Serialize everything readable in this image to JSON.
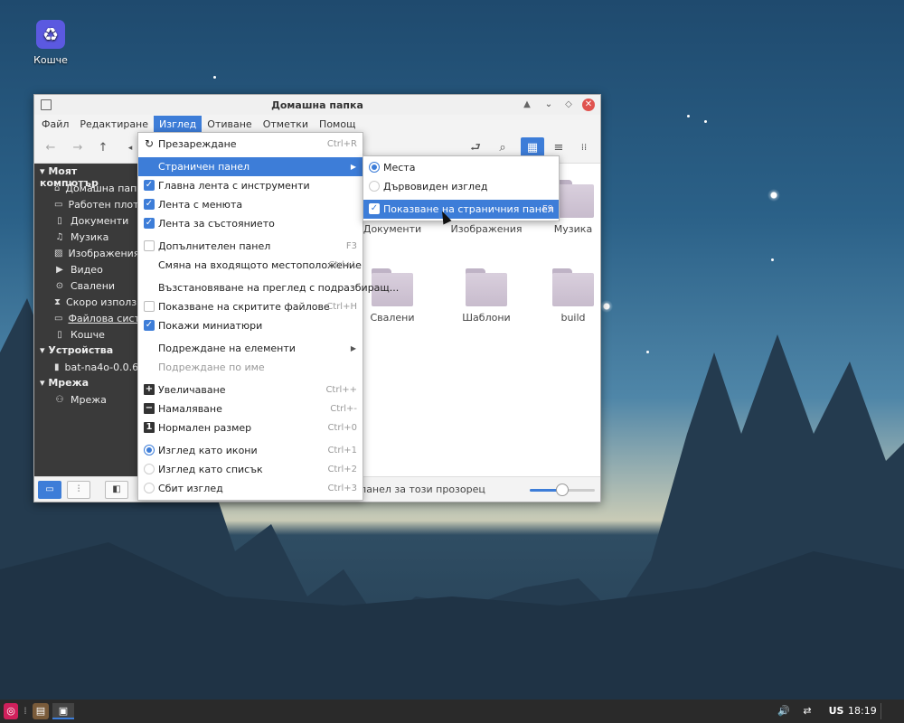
{
  "desktop": {
    "trash_label": "Кошче"
  },
  "window": {
    "title": "Домашна папка",
    "menubar": [
      "Файл",
      "Редактиране",
      "Изглед",
      "Отиване",
      "Отметки",
      "Помощ"
    ],
    "active_menu": "Изглед"
  },
  "sidebar": {
    "sections": [
      {
        "title": "Моят компютър",
        "items": [
          {
            "label": "Домашна пап...",
            "icon": "home-icon"
          },
          {
            "label": "Работен плот",
            "icon": "desktop-icon"
          },
          {
            "label": "Документи",
            "icon": "document-icon"
          },
          {
            "label": "Музика",
            "icon": "music-icon"
          },
          {
            "label": "Изображения",
            "icon": "image-icon"
          },
          {
            "label": "Видео",
            "icon": "video-icon"
          },
          {
            "label": "Свалени",
            "icon": "download-icon"
          },
          {
            "label": "Скоро използ...",
            "icon": "recent-icon"
          },
          {
            "label": "Файлова сист...",
            "icon": "filesystem-icon"
          },
          {
            "label": "Кошче",
            "icon": "trash-icon"
          }
        ]
      },
      {
        "title": "Устройства",
        "items": [
          {
            "label": "bat-na4o-0.0.6",
            "icon": "drive-icon"
          }
        ]
      },
      {
        "title": "Мрежа",
        "items": [
          {
            "label": "Мрежа",
            "icon": "network-icon"
          }
        ]
      }
    ]
  },
  "folders": [
    {
      "label": "Документи"
    },
    {
      "label": "Изображения"
    },
    {
      "label": "Музика"
    },
    {
      "label": "Свалени"
    },
    {
      "label": "Шаблони"
    },
    {
      "label": "build"
    }
  ],
  "statusbar": {
    "text": "панел за този прозорец",
    "zoom_fraction": 0.5
  },
  "view_menu": [
    {
      "label": "Презареждане",
      "shortcut": "Ctrl+R",
      "lead": "reload-icon"
    },
    {
      "label": "Страничен панел",
      "submenu": true,
      "highlighted": true
    },
    {
      "label": "Главна лента с инструменти",
      "check": true
    },
    {
      "label": "Лента с менюта",
      "check": true
    },
    {
      "label": "Лента за състоянието",
      "check": true
    },
    {
      "label": "Допълнителен панел",
      "shortcut": "F3",
      "check": false
    },
    {
      "label": "Смяна на входящото местоположение",
      "shortcut": "Ctrl+L"
    },
    {
      "label": "Възстановяване на преглед с подразбиращ..."
    },
    {
      "label": "Показване на скритите файлове",
      "shortcut": "Ctrl+H",
      "check": false
    },
    {
      "label": "Покажи миниатюри",
      "check": true
    },
    {
      "label": "Подреждане на елементи",
      "submenu": true
    },
    {
      "label": "Подреждане по име",
      "disabled": true
    },
    {
      "label": "Увеличаване",
      "shortcut": "Ctrl++",
      "lead": "zoom-in-icon"
    },
    {
      "label": "Намаляване",
      "shortcut": "Ctrl+-",
      "lead": "zoom-out-icon"
    },
    {
      "label": "Нормален размер",
      "shortcut": "Ctrl+0",
      "lead": "normal-size-icon"
    },
    {
      "label": "Изглед като икони",
      "shortcut": "Ctrl+1",
      "radio": true
    },
    {
      "label": "Изглед като списък",
      "shortcut": "Ctrl+2",
      "radio": false
    },
    {
      "label": "Сбит изглед",
      "shortcut": "Ctrl+3",
      "radio": false
    }
  ],
  "side_panel_submenu": [
    {
      "label": "Места",
      "radio": true
    },
    {
      "label": "Дървовиден изглед",
      "radio": false
    },
    {
      "label": "Показване на страничния панел",
      "shortcut": "F9",
      "check": true,
      "highlighted": true
    }
  ],
  "taskbar": {
    "keyboard_layout": "US",
    "clock": "18:19"
  },
  "colors": {
    "accent": "#3d7dd8",
    "sidebar_bg": "#3a3a3a",
    "taskbar_bg": "#2a2a2a"
  }
}
